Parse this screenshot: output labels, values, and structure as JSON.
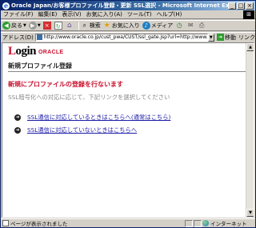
{
  "window": {
    "title": "Oracle Japan/お客様プロファイル登録・更新 SSL選択 - Microsoft Internet Explorer",
    "buttons": [
      "_",
      "□",
      "×"
    ]
  },
  "menu": [
    "ファイル(F)",
    "編集(E)",
    "表示(V)",
    "お気に入り(A)",
    "ツール(T)",
    "ヘルプ(H)"
  ],
  "toolbar": {
    "back_label": "戻る",
    "search_label": "検索",
    "favorites_label": "お気に入り",
    "media_label": "メディア"
  },
  "address": {
    "label": "アドレス(D)",
    "url": "http://www.oracle.co.jp/cust_pwa/CUST/ssl_gate.jsp?url=http://www.oracle.co.jp/ent_pt/entry...",
    "go_label": "移動",
    "links_label": "リンク"
  },
  "logo": {
    "login_l": "L",
    "login_rest": "ogin",
    "oracle": "ORACLE"
  },
  "content": {
    "heading": "新規プロファイル登録",
    "red_heading": "新規にプロファイルの登録を行ないます",
    "instruction": "SSL暗号化への対応に応じて、下記リンクを選択してください",
    "links": [
      "SSL通信に対応しているときはこちらへ(通常はこちら)",
      "SSL通信に対応していないときはこちらへ"
    ]
  },
  "status": {
    "text": "ページが表示されました",
    "zone": "インターネット"
  },
  "colors": {
    "accent_red": "#c8102e",
    "link_blue": "#1a1aa8",
    "title_gradient_start": "#0a246a"
  }
}
